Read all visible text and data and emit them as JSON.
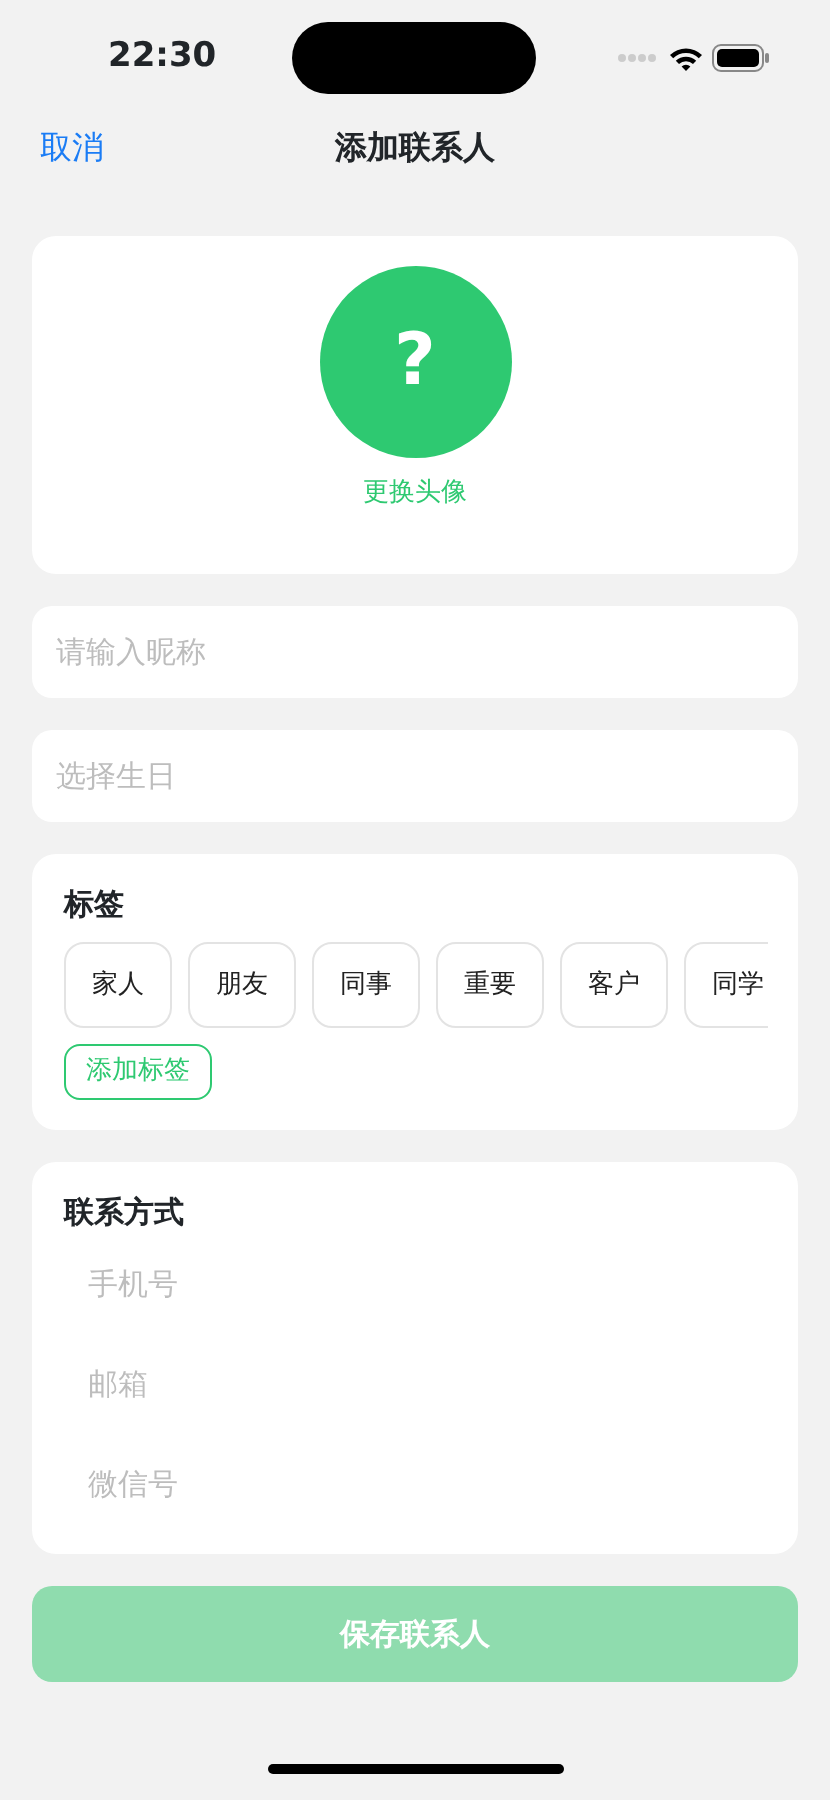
{
  "status_bar": {
    "time": "22:30"
  },
  "nav": {
    "cancel": "取消",
    "title": "添加联系人"
  },
  "avatar": {
    "symbol": "?",
    "action": "更换头像"
  },
  "fields": [
    {
      "placeholder": "请输入昵称"
    },
    {
      "placeholder": "选择生日"
    }
  ],
  "tags": {
    "title": "标签",
    "items": [
      {
        "label": "家人",
        "selected": false
      },
      {
        "label": "朋友",
        "selected": false
      },
      {
        "label": "同事",
        "selected": false
      },
      {
        "label": "重要",
        "selected": false
      },
      {
        "label": "客户",
        "selected": false
      },
      {
        "label": "同学",
        "selected": false
      }
    ],
    "add": "添加标签"
  },
  "contact": {
    "title": "联系方式",
    "fields": [
      {
        "placeholder": "手机号"
      },
      {
        "placeholder": "邮箱"
      },
      {
        "placeholder": "微信号"
      }
    ]
  },
  "save_button": {
    "label": "保存联系人",
    "disabled": true
  }
}
